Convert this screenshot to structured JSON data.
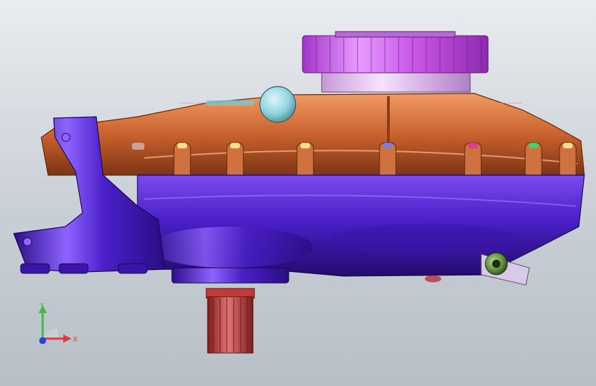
{
  "viewport": {
    "background_top": "#e9ecf0",
    "background_bottom": "#b8bfc7"
  },
  "model": {
    "colors": {
      "upper_housing": "#c9622e",
      "lower_housing": "#4a1fc8",
      "gear_top": "#c957e6",
      "shaft_spline": "#c23b3b",
      "cap_cyan": "#8fd3dd",
      "fitting_green": "#5c8a3a"
    }
  },
  "triad": {
    "x_label": "X",
    "y_label": "Y",
    "x_color": "#e23a3a",
    "y_color": "#3bbf3b",
    "z_color": "#2a3ee8"
  }
}
